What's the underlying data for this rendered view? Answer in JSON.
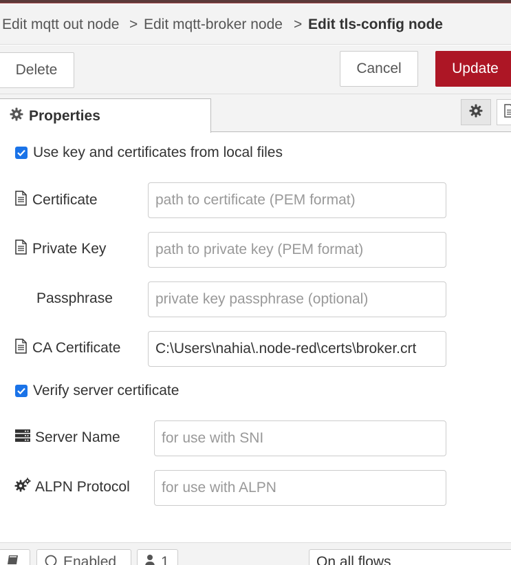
{
  "breadcrumb": {
    "items": [
      "Edit mqtt out node",
      "Edit mqtt-broker node"
    ],
    "separator": ">",
    "current": "Edit tls-config node"
  },
  "toolbar": {
    "delete_label": "Delete",
    "cancel_label": "Cancel",
    "update_label": "Update",
    "primary_color": "#ad1625"
  },
  "tabs": {
    "active_label": "Properties",
    "active_icon": "gear-icon"
  },
  "form": {
    "use_local_files": {
      "label": "Use key and certificates from local files",
      "checked": true
    },
    "certificate": {
      "label": "Certificate",
      "placeholder": "path to certificate (PEM format)",
      "icon": "file-icon"
    },
    "private_key": {
      "label": "Private Key",
      "placeholder": "path to private key (PEM format)",
      "icon": "file-icon"
    },
    "passphrase": {
      "label": "Passphrase",
      "placeholder": "private key passphrase (optional)"
    },
    "ca_certificate": {
      "label": "CA Certificate",
      "value": "C:\\Users\\nahia\\.node-red\\certs\\broker.crt",
      "icon": "file-icon"
    },
    "verify_server": {
      "label": "Verify server certificate",
      "checked": true
    },
    "server_name": {
      "label": "Server Name",
      "placeholder": "for use with SNI",
      "icon": "server-icon"
    },
    "alpn_protocol": {
      "label": "ALPN Protocol",
      "placeholder": "for use with ALPN",
      "icon": "gears-icon"
    }
  },
  "footer": {
    "enabled_label": "Enabled",
    "users_count": "1",
    "scope_label": "On all flows"
  }
}
